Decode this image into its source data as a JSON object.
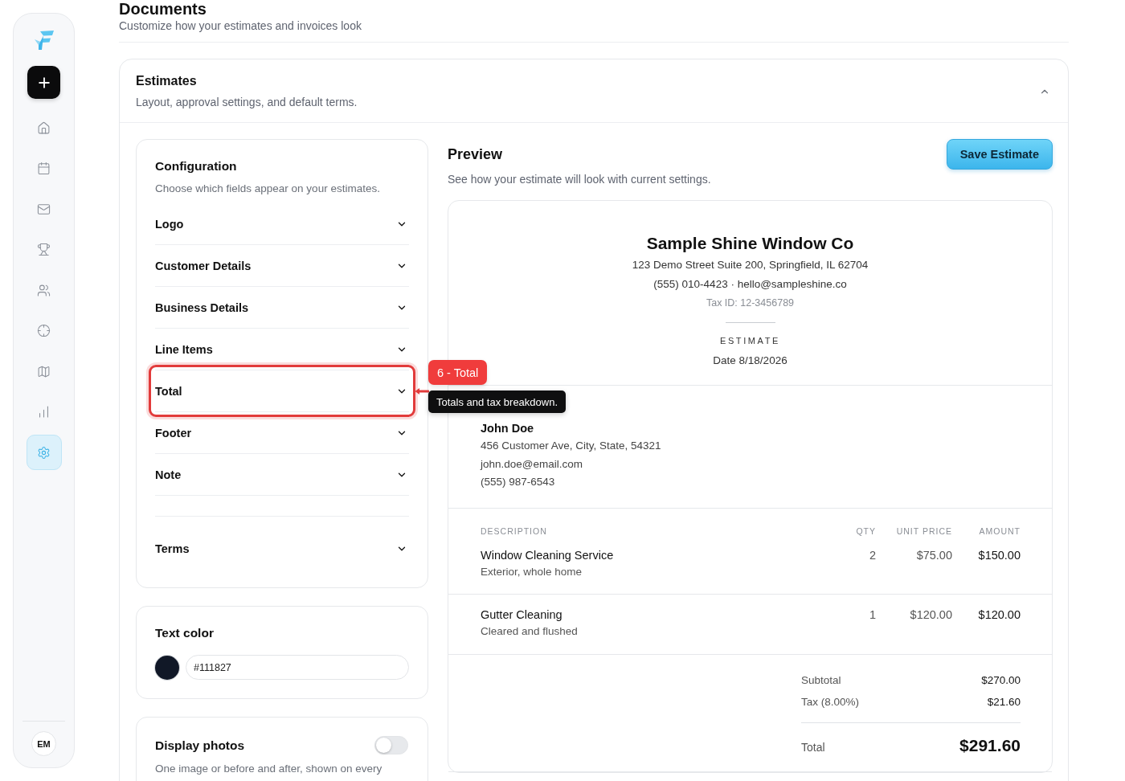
{
  "sidebar": {
    "nav": [
      {
        "selected": false
      },
      {
        "selected": false
      },
      {
        "selected": false
      },
      {
        "selected": false
      },
      {
        "selected": false
      },
      {
        "selected": false
      },
      {
        "selected": false
      },
      {
        "selected": false
      },
      {
        "selected": true
      }
    ],
    "avatar": "EM"
  },
  "page": {
    "title": "Documents",
    "subtitle": "Customize how your estimates and invoices look"
  },
  "section": {
    "title": "Estimates",
    "subtitle": "Layout, approval settings, and default terms.",
    "expanded": true
  },
  "configuration": {
    "title": "Configuration",
    "subtitle": "Choose which fields appear on your estimates.",
    "fields": [
      {
        "label": "Logo",
        "expanded": false,
        "highlighted": false
      },
      {
        "label": "Customer Details",
        "expanded": false,
        "highlighted": false
      },
      {
        "label": "Business Details",
        "expanded": false,
        "highlighted": false
      },
      {
        "label": "Line Items",
        "expanded": false,
        "highlighted": false
      },
      {
        "label": "Total",
        "expanded": false,
        "highlighted": true
      },
      {
        "label": "Footer",
        "expanded": false,
        "highlighted": false
      },
      {
        "label": "Note",
        "expanded": false,
        "highlighted": false
      },
      {
        "label": "Terms",
        "expanded": false,
        "highlighted": false
      }
    ]
  },
  "annotation": {
    "badge": "6 - Total",
    "tooltip": "Totals and tax breakdown."
  },
  "text_color": {
    "title": "Text color",
    "color": "#111827",
    "value": "#111827"
  },
  "display_photos": {
    "title": "Display photos",
    "on": false,
    "description": "One image or before and after, shown on every"
  },
  "preview": {
    "title": "Preview",
    "subtitle": "See how your estimate will look with current settings.",
    "save_button": "Save Estimate",
    "document": {
      "company": "Sample Shine Window Co",
      "address": "123 Demo Street Suite 200, Springfield, IL 62704",
      "contact": "(555) 010-4423 · hello@sampleshine.co",
      "tax_id": "Tax ID: 12-3456789",
      "doc_type": "ESTIMATE",
      "date": "Date 8/18/2026",
      "customer": {
        "name": "John Doe",
        "lines": [
          "456 Customer Ave, City, State, 54321",
          "john.doe@email.com",
          "(555) 987-6543"
        ]
      },
      "columns": [
        "DESCRIPTION",
        "QTY",
        "UNIT PRICE",
        "AMOUNT"
      ],
      "items": [
        {
          "name": "Window Cleaning Service",
          "detail": "Exterior, whole home",
          "qty": "2",
          "unit_price": "$75.00",
          "amount": "$150.00"
        },
        {
          "name": "Gutter Cleaning",
          "detail": "Cleared and flushed",
          "qty": "1",
          "unit_price": "$120.00",
          "amount": "$120.00"
        }
      ],
      "totals": [
        {
          "label": "Subtotal",
          "value": "$270.00"
        },
        {
          "label": "Tax (8.00%)",
          "value": "$21.60"
        }
      ],
      "grand_total": {
        "label": "Total",
        "value": "$291.60"
      }
    }
  }
}
